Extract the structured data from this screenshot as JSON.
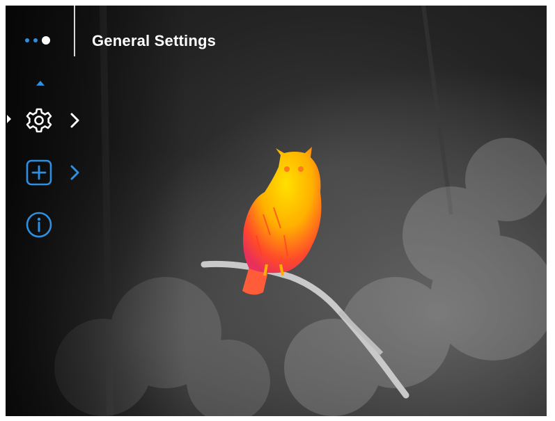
{
  "header": {
    "title": "General Settings",
    "page_indicator": {
      "total": 3,
      "active_index": 2
    }
  },
  "sidebar": {
    "items": [
      {
        "icon": "gear-icon",
        "selected": true,
        "has_submenu": true,
        "color": "#ffffff"
      },
      {
        "icon": "add-square-icon",
        "selected": false,
        "has_submenu": true,
        "color": "#2f8fe0"
      },
      {
        "icon": "info-icon",
        "selected": false,
        "has_submenu": false,
        "color": "#2f8fe0"
      }
    ]
  },
  "colors": {
    "accent": "#2f8fe0",
    "text": "#ffffff"
  }
}
